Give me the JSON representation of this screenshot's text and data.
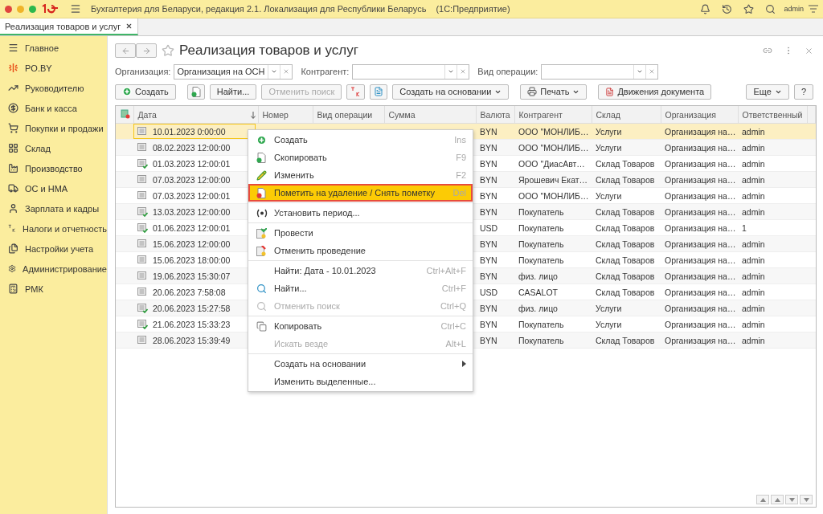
{
  "window": {
    "title": "Бухгалтерия для Беларуси, редакция 2.1. Локализация для Республики Беларусь",
    "platform": "(1С:Предприятие)",
    "user": "admin"
  },
  "open_tabs": [
    {
      "label": "Реализация товаров и услуг",
      "selected": true
    }
  ],
  "sidebar": {
    "items": [
      {
        "label": "Главное"
      },
      {
        "label": "PO.BY"
      },
      {
        "label": "Руководителю"
      },
      {
        "label": "Банк и касса"
      },
      {
        "label": "Покупки и продажи"
      },
      {
        "label": "Склад"
      },
      {
        "label": "Производство"
      },
      {
        "label": "ОС и НМА"
      },
      {
        "label": "Зарплата и кадры"
      },
      {
        "label": "Налоги и отчетность"
      },
      {
        "label": "Настройки учета"
      },
      {
        "label": "Администрирование"
      },
      {
        "label": "РМК"
      }
    ]
  },
  "form": {
    "title": "Реализация товаров и услуг",
    "filters": [
      {
        "label": "Организация:",
        "value": "Организация на ОСН"
      },
      {
        "label": "Контрагент:"
      },
      {
        "label": "Вид операции:"
      }
    ],
    "toolbar": {
      "create": "Создать",
      "find": "Найти...",
      "cancel_search": "Отменить поиск",
      "create_based": "Создать на основании",
      "print": "Печать",
      "movements": "Движения документа",
      "more": "Еще",
      "help": "?"
    },
    "table": {
      "columns": [
        "Дата",
        "Номер",
        "Вид операции",
        "Сумма",
        "Валюта",
        "Контрагент",
        "Склад",
        "Организация",
        "Ответственный"
      ],
      "rows": [
        {
          "date": "10.01.2023 0:00:00",
          "posted": false,
          "selected": true,
          "currency": "BYN",
          "counterparty": "ООО \"МОНЛИБ…",
          "warehouse": "Услуги",
          "organization": "Организация на…",
          "responsible": "admin"
        },
        {
          "date": "08.02.2023 12:00:00",
          "posted": false,
          "selected": false,
          "currency": "BYN",
          "counterparty": "ООО \"МОНЛИБ…",
          "warehouse": "Услуги",
          "organization": "Организация на…",
          "responsible": "admin"
        },
        {
          "date": "01.03.2023 12:00:01",
          "posted": true,
          "selected": false,
          "currency": "BYN",
          "counterparty": "ООО \"ДиасАвт…",
          "warehouse": "Склад Товаров",
          "organization": "Организация на…",
          "responsible": "admin"
        },
        {
          "date": "07.03.2023 12:00:00",
          "posted": false,
          "selected": false,
          "currency": "BYN",
          "counterparty": "Ярошевич Екат…",
          "warehouse": "Склад Товаров",
          "organization": "Организация на…",
          "responsible": "admin"
        },
        {
          "date": "07.03.2023 12:00:01",
          "posted": false,
          "selected": false,
          "currency": "BYN",
          "counterparty": "ООО \"МОНЛИБ…",
          "warehouse": "Услуги",
          "organization": "Организация на…",
          "responsible": "admin"
        },
        {
          "date": "13.03.2023 12:00:00",
          "posted": true,
          "selected": false,
          "currency": "BYN",
          "counterparty": "Покупатель",
          "warehouse": "Склад Товаров",
          "organization": "Организация на…",
          "responsible": "admin"
        },
        {
          "date": "01.06.2023 12:00:01",
          "posted": true,
          "selected": false,
          "currency": "USD",
          "counterparty": "Покупатель",
          "warehouse": "Склад Товаров",
          "organization": "Организация на…",
          "responsible": "1"
        },
        {
          "date": "15.06.2023 12:00:00",
          "posted": false,
          "selected": false,
          "currency": "BYN",
          "counterparty": "Покупатель",
          "warehouse": "Склад Товаров",
          "organization": "Организация на…",
          "responsible": "admin"
        },
        {
          "date": "15.06.2023 18:00:00",
          "posted": false,
          "selected": false,
          "currency": "BYN",
          "counterparty": "Покупатель",
          "warehouse": "Склад Товаров",
          "organization": "Организация на…",
          "responsible": "admin"
        },
        {
          "date": "19.06.2023 15:30:07",
          "posted": false,
          "selected": false,
          "currency": "BYN",
          "counterparty": "физ. лицо",
          "warehouse": "Склад Товаров",
          "organization": "Организация на…",
          "responsible": "admin"
        },
        {
          "date": "20.06.2023 7:58:08",
          "posted": false,
          "selected": false,
          "currency": "USD",
          "counterparty": "CASALOT",
          "warehouse": "Склад Товаров",
          "organization": "Организация на…",
          "responsible": "admin"
        },
        {
          "date": "20.06.2023 15:27:58",
          "posted": true,
          "selected": false,
          "currency": "BYN",
          "counterparty": "физ. лицо",
          "warehouse": "Услуги",
          "organization": "Организация на…",
          "responsible": "admin"
        },
        {
          "date": "21.06.2023 15:33:23",
          "posted": true,
          "selected": false,
          "currency": "BYN",
          "counterparty": "Покупатель",
          "warehouse": "Услуги",
          "organization": "Организация на…",
          "responsible": "admin"
        },
        {
          "date": "28.06.2023 15:39:49",
          "posted": false,
          "selected": false,
          "currency": "BYN",
          "counterparty": "Покупатель",
          "warehouse": "Склад Товаров",
          "organization": "Организация на…",
          "responsible": "admin"
        }
      ]
    }
  },
  "context_menu": {
    "items": [
      {
        "kind": "item",
        "label": "Создать",
        "shortcut": "Ins",
        "disabled": false,
        "selected": false
      },
      {
        "kind": "item",
        "label": "Скопировать",
        "shortcut": "F9",
        "disabled": false,
        "selected": false
      },
      {
        "kind": "item",
        "label": "Изменить",
        "shortcut": "F2",
        "disabled": false,
        "selected": false
      },
      {
        "kind": "item",
        "label": "Пометить на удаление / Снять пометку",
        "shortcut": "Del",
        "disabled": false,
        "selected": true
      },
      {
        "kind": "separator"
      },
      {
        "kind": "item",
        "label": "Установить период...",
        "disabled": false,
        "selected": false
      },
      {
        "kind": "separator"
      },
      {
        "kind": "item",
        "label": "Провести",
        "disabled": false,
        "selected": false
      },
      {
        "kind": "item",
        "label": "Отменить проведение",
        "disabled": false,
        "selected": false
      },
      {
        "kind": "separator"
      },
      {
        "kind": "item",
        "label": "Найти: Дата - 10.01.2023",
        "shortcut": "Ctrl+Alt+F",
        "disabled": false,
        "selected": false
      },
      {
        "kind": "item",
        "label": "Найти...",
        "shortcut": "Ctrl+F",
        "disabled": false,
        "selected": false
      },
      {
        "kind": "item",
        "label": "Отменить поиск",
        "shortcut": "Ctrl+Q",
        "disabled": true,
        "selected": false
      },
      {
        "kind": "separator"
      },
      {
        "kind": "item",
        "label": "Копировать",
        "shortcut": "Ctrl+C",
        "disabled": false,
        "selected": false
      },
      {
        "kind": "item",
        "label": "Искать везде",
        "shortcut": "Alt+L",
        "disabled": true,
        "selected": false
      },
      {
        "kind": "separator"
      },
      {
        "kind": "submenu",
        "label": "Создать на основании",
        "disabled": false,
        "selected": false
      },
      {
        "kind": "item",
        "label": "Изменить выделенные...",
        "disabled": false,
        "selected": false
      }
    ]
  }
}
